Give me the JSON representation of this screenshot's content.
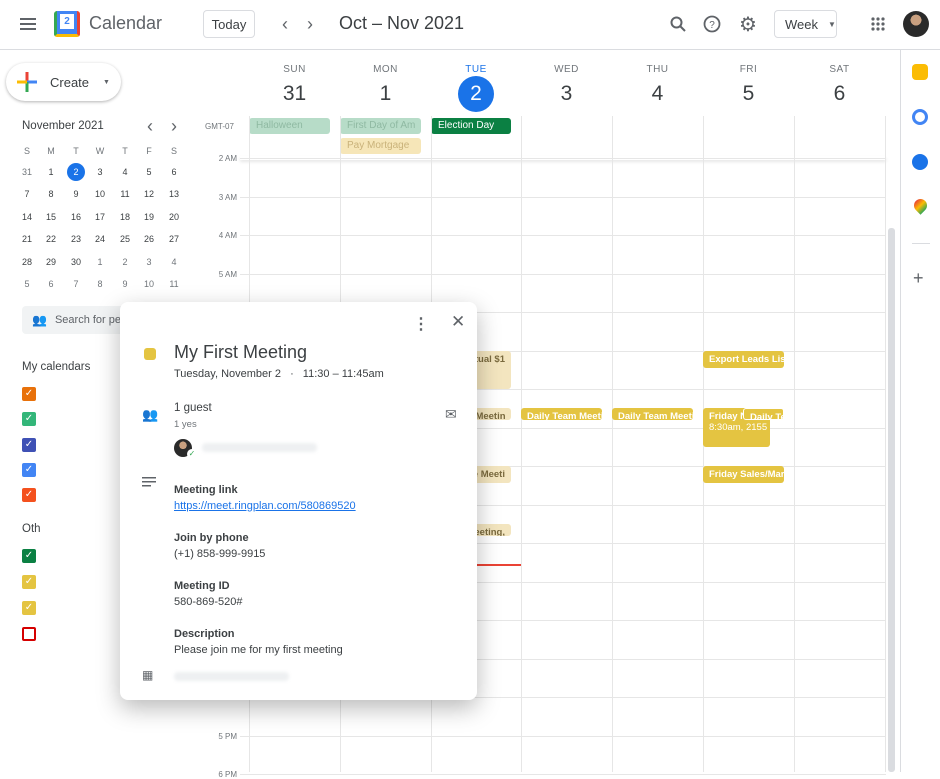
{
  "header": {
    "app_name": "Calendar",
    "logo_day": "2",
    "today_label": "Today",
    "date_range": "Oct – Nov 2021",
    "view_label": "Week"
  },
  "create_label": "Create",
  "mini_calendar": {
    "title": "November 2021",
    "weekdays": [
      "S",
      "M",
      "T",
      "W",
      "T",
      "F",
      "S"
    ],
    "weeks": [
      [
        "31",
        "1",
        "2",
        "3",
        "4",
        "5",
        "6"
      ],
      [
        "7",
        "8",
        "9",
        "10",
        "11",
        "12",
        "13"
      ],
      [
        "14",
        "15",
        "16",
        "17",
        "18",
        "19",
        "20"
      ],
      [
        "21",
        "22",
        "23",
        "24",
        "25",
        "26",
        "27"
      ],
      [
        "28",
        "29",
        "30",
        "1",
        "2",
        "3",
        "4"
      ],
      [
        "5",
        "6",
        "7",
        "8",
        "9",
        "10",
        "11"
      ]
    ],
    "selected": "2"
  },
  "search_people_placeholder": "Search for pe",
  "my_calendars": {
    "title": "My calendars",
    "colors": [
      "#e8710a",
      "#33b679",
      "#3f51b5",
      "#4285f4",
      "#f4511e"
    ]
  },
  "other_calendars": {
    "title": "Oth",
    "colors": [
      "#0b8043",
      "#e4c441",
      "#e4c441",
      "#d50000"
    ],
    "checked": [
      true,
      true,
      true,
      false
    ]
  },
  "week": {
    "timezone": "GMT-07",
    "days": [
      {
        "name": "SUN",
        "num": "31"
      },
      {
        "name": "MON",
        "num": "1"
      },
      {
        "name": "TUE",
        "num": "2",
        "today": true
      },
      {
        "name": "WED",
        "num": "3"
      },
      {
        "name": "THU",
        "num": "4"
      },
      {
        "name": "FRI",
        "num": "5"
      },
      {
        "name": "SAT",
        "num": "6"
      }
    ],
    "all_day": [
      {
        "day": 0,
        "row": 0,
        "title": "Halloween",
        "bg": "#b7dcc8",
        "fg": "#8fb9a2"
      },
      {
        "day": 1,
        "row": 0,
        "title": "First Day of Am",
        "bg": "#b7dcc8",
        "fg": "#8fb9a2"
      },
      {
        "day": 1,
        "row": 1,
        "title": "Pay Mortgage",
        "bg": "#f6e6b8",
        "fg": "#c9b27a"
      },
      {
        "day": 2,
        "row": 0,
        "title": "Election Day",
        "bg": "#0b8043",
        "fg": "#ffffff"
      }
    ],
    "time_labels": [
      {
        "label": "2 AM",
        "hour": 2
      },
      {
        "label": "3 AM",
        "hour": 3
      },
      {
        "label": "4 AM",
        "hour": 4
      },
      {
        "label": "5 AM",
        "hour": 5
      },
      {
        "label": "5 PM",
        "hour": 17
      },
      {
        "label": "6 PM",
        "hour": 18
      }
    ],
    "events": [
      {
        "day": 2,
        "start": 7,
        "end": 8,
        "title": "utual $1",
        "pale": true
      },
      {
        "day": 2,
        "start": 8.5,
        "end": 8.8,
        "title": "n Meetin",
        "pale": true
      },
      {
        "day": 2,
        "start": 10,
        "end": 10.45,
        "title": "e Meeti",
        "pale": true
      },
      {
        "day": 2,
        "start": 11.5,
        "end": 11.8,
        "title": "leeting,",
        "pale": true
      },
      {
        "day": 3,
        "start": 8.5,
        "end": 8.8,
        "title": "Daily Team Meeting"
      },
      {
        "day": 4,
        "start": 8.5,
        "end": 8.8,
        "title": "Daily Team Meeting"
      },
      {
        "day": 5,
        "start": 7,
        "end": 7.45,
        "title": "Export Leads List"
      },
      {
        "day": 5,
        "start": 8.5,
        "end": 9.5,
        "title": "Friday N",
        "subtitle": "8:30am, 2155",
        "narrow": true
      },
      {
        "day": 5,
        "start": 8.5,
        "end": 8.8,
        "title": "Daily Team Meeting",
        "overlap": true
      },
      {
        "day": 5,
        "start": 10,
        "end": 10.45,
        "title": "Friday Sales/Marketing"
      }
    ],
    "current_time_hour": 12.55,
    "current_time_color": "#ea4335"
  },
  "popup": {
    "color": "#e4c441",
    "title": "My First Meeting",
    "date": "Tuesday, November 2",
    "time": "11:30 – 11:45am",
    "guests": "1 guest",
    "guests_summary": "1 yes",
    "meeting_link_label": "Meeting link",
    "meeting_link": "https://meet.ringplan.com/580869520",
    "phone_label": "Join by phone",
    "phone": "(+1) 858-999-9915",
    "meeting_id_label": "Meeting ID",
    "meeting_id": "580-869-520#",
    "description_label": "Description",
    "description": "Please join me for my first meeting"
  }
}
